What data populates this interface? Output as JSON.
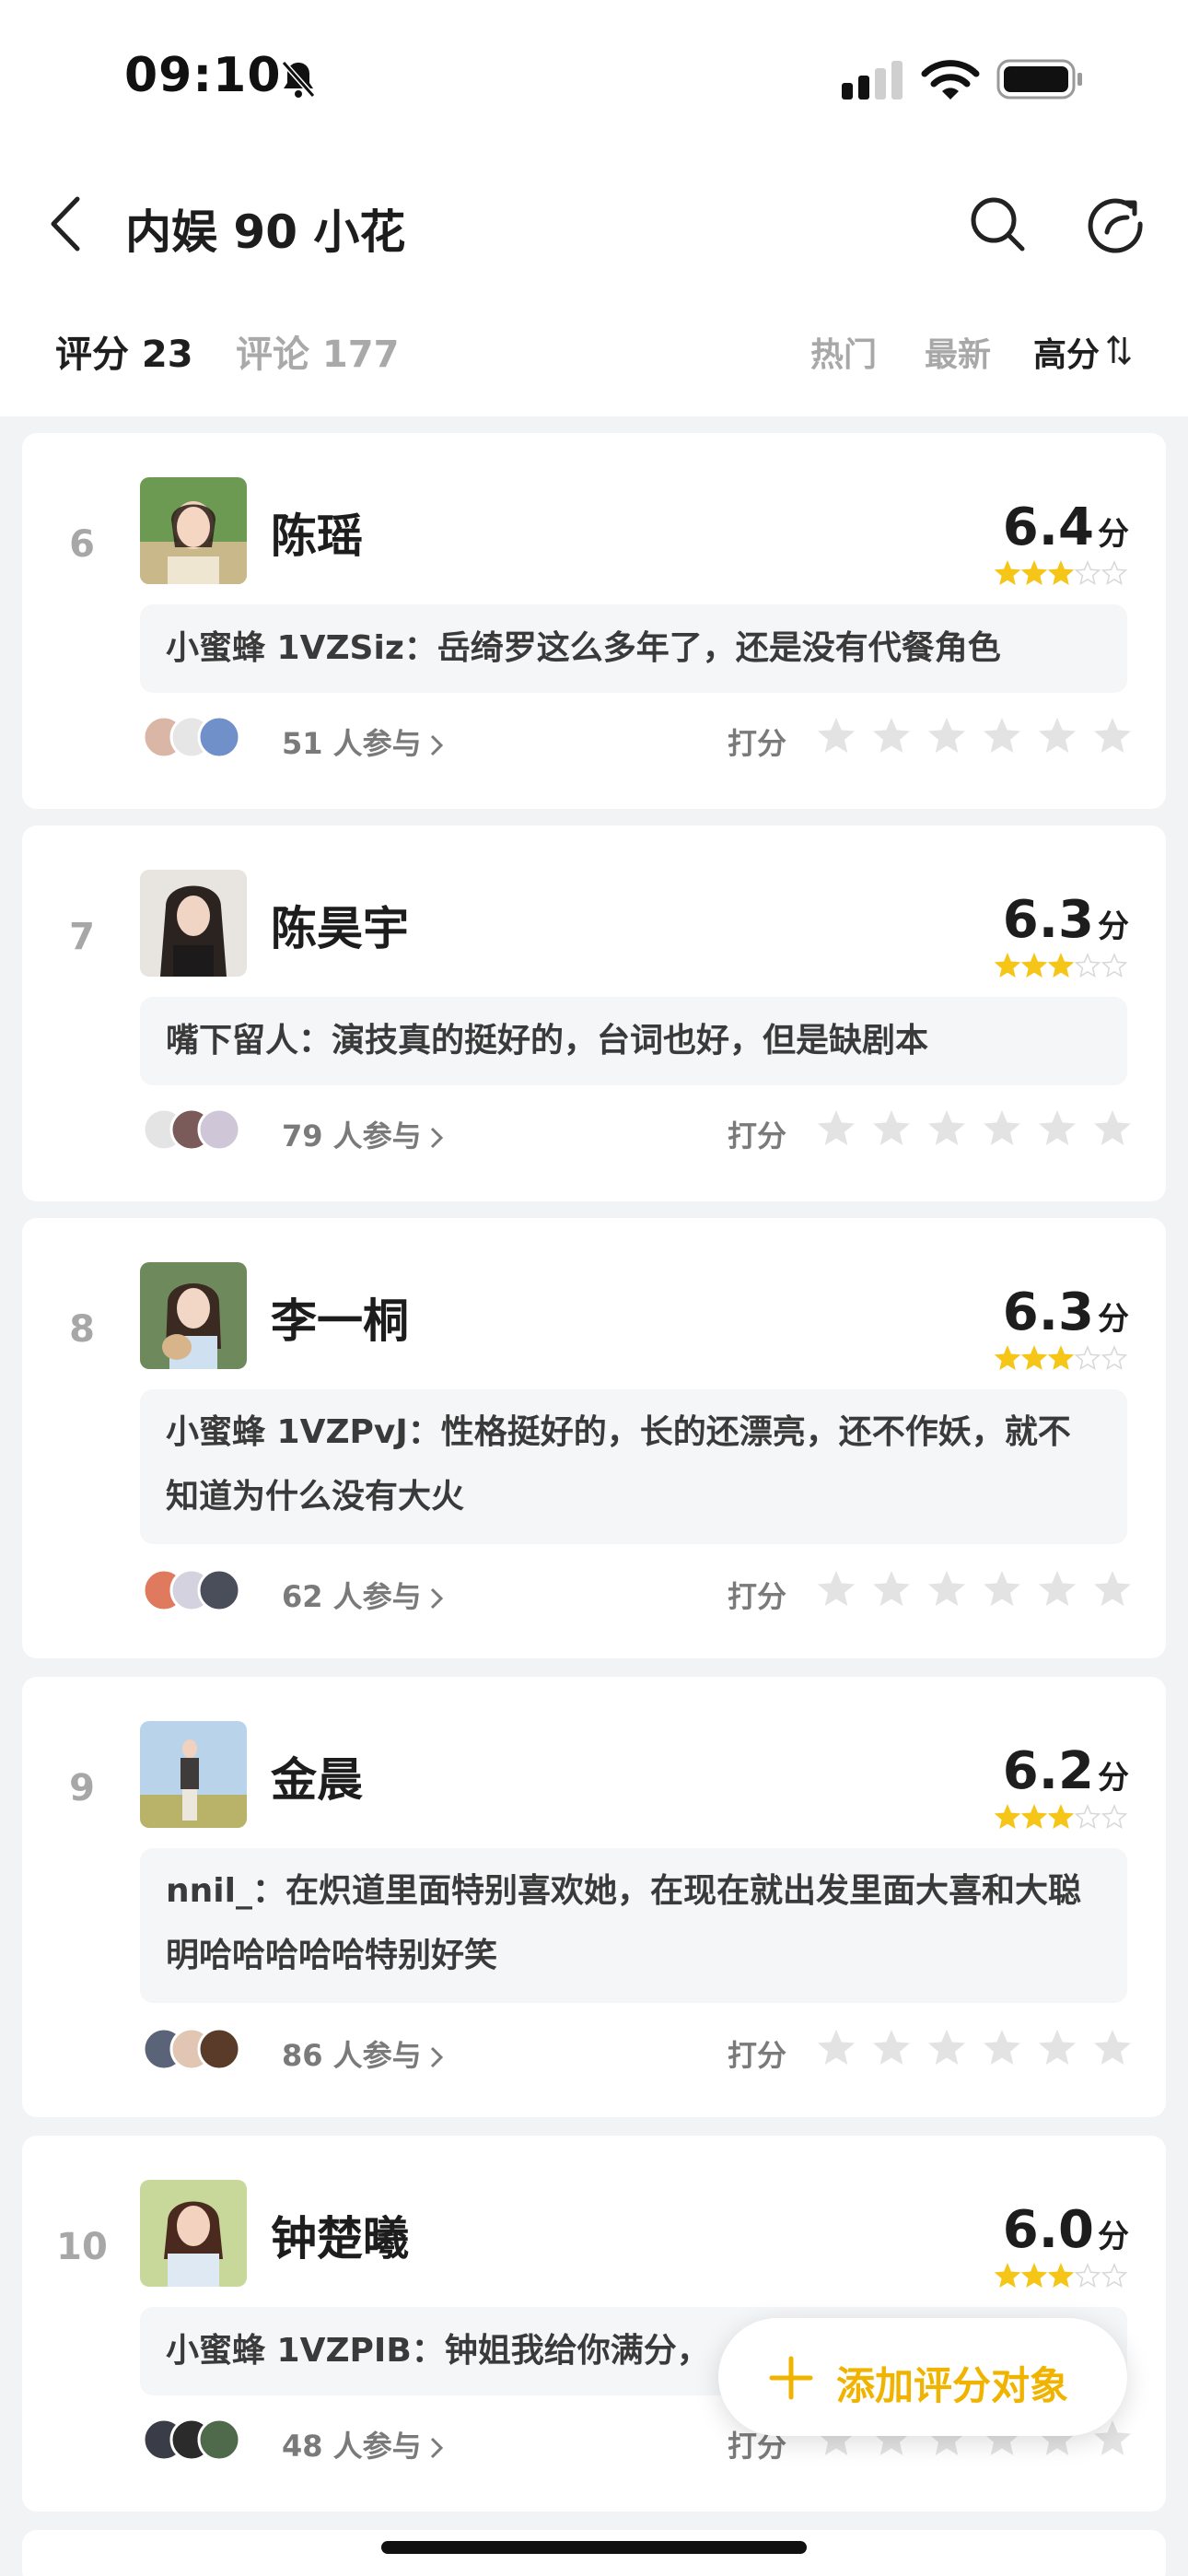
{
  "status_bar": {
    "time": "09:10"
  },
  "header": {
    "title": "内娱 90 小花",
    "tabs": [
      {
        "label": "评分 23",
        "active": true
      },
      {
        "label": "评论 177",
        "active": false
      }
    ],
    "sort_options": [
      "热门",
      "最新",
      "高分"
    ],
    "selected_sort": "高分"
  },
  "colors": {
    "accent": "#f0b400",
    "star_filled": "#f5c518",
    "star_empty": "#e3e3e3"
  },
  "cards": [
    {
      "rank": "6",
      "name": "陈瑶",
      "score": "6.4",
      "score_unit": "分",
      "stars": 3,
      "comment": "小蜜蜂 1VZSiz：岳绮罗这么多年了，还是没有代餐角色",
      "participants": "51 人参与",
      "rate_label": "打分"
    },
    {
      "rank": "7",
      "name": "陈昊宇",
      "score": "6.3",
      "score_unit": "分",
      "stars": 3,
      "comment": "嘴下留人：演技真的挺好的，台词也好，但是缺剧本",
      "participants": "79 人参与",
      "rate_label": "打分"
    },
    {
      "rank": "8",
      "name": "李一桐",
      "score": "6.3",
      "score_unit": "分",
      "stars": 3,
      "comment": "小蜜蜂 1VZPvJ：性格挺好的，长的还漂亮，还不作妖，就不知道为什么没有大火",
      "participants": "62 人参与",
      "rate_label": "打分"
    },
    {
      "rank": "9",
      "name": "金晨",
      "score": "6.2",
      "score_unit": "分",
      "stars": 3,
      "comment": "nnil_：在炽道里面特别喜欢她，在现在就出发里面大喜和大聪明哈哈哈哈哈特别好笑",
      "participants": "86 人参与",
      "rate_label": "打分"
    },
    {
      "rank": "10",
      "name": "钟楚曦",
      "score": "6.0",
      "score_unit": "分",
      "stars": 3,
      "comment": "小蜜蜂 1VZPIB：钟姐我给你满分，",
      "participants": "48 人参与",
      "rate_label": "打分"
    }
  ],
  "fab": {
    "label": "添加评分对象",
    "icon": "plus-icon"
  }
}
